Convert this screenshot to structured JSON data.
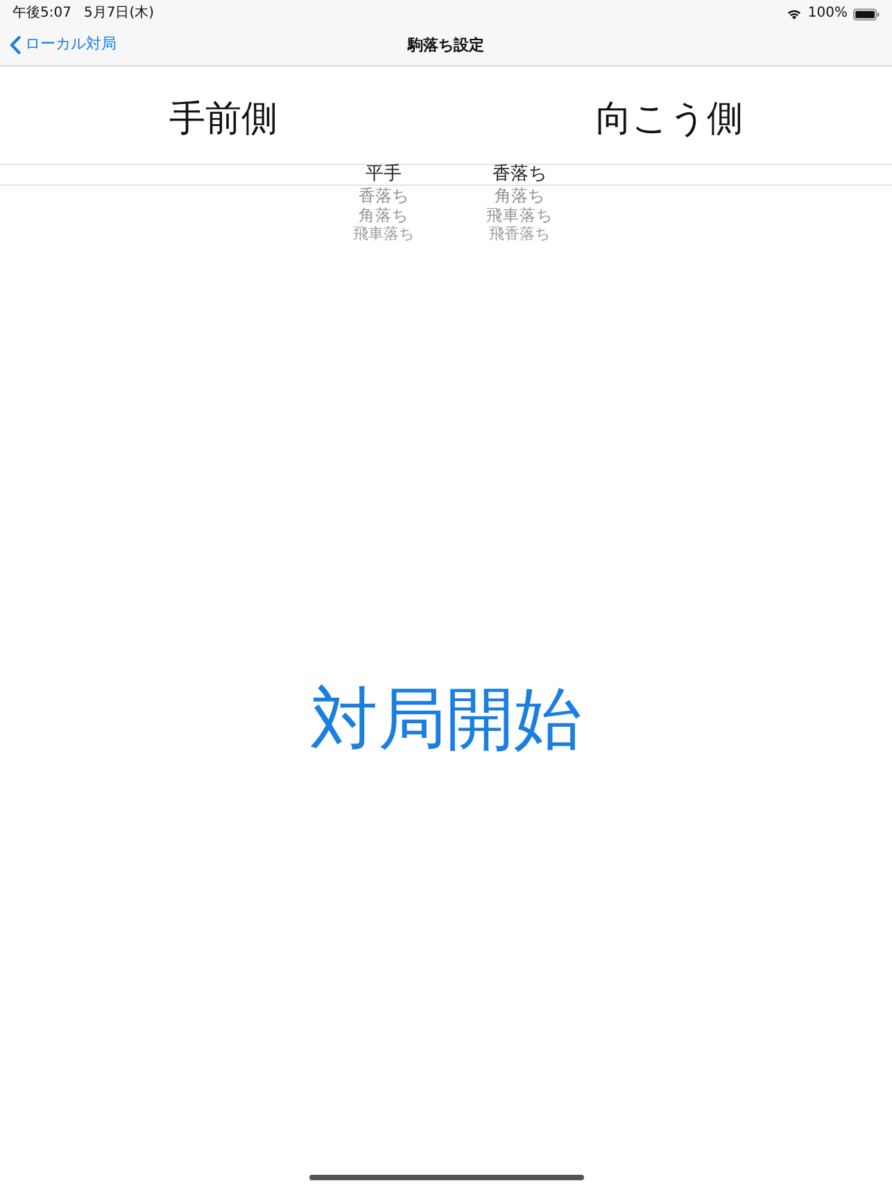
{
  "status_bar": {
    "time": "午後5:07",
    "date": "5月7日(木)",
    "battery": "100%"
  },
  "nav_bar": {
    "back": "ローカル対局",
    "title": "駒落ち設定"
  },
  "headers": [
    "手前側",
    "向こう側"
  ],
  "picker": {
    "columns": [
      {
        "items": [
          {
            "label": "平手",
            "selected": true
          },
          {
            "label": "香落ち",
            "selected": false
          },
          {
            "label": "角落ち",
            "selected": false
          },
          {
            "label": "飛車落ち",
            "selected": false
          }
        ]
      },
      {
        "items": [
          {
            "label": "香落ち",
            "selected": true
          },
          {
            "label": "角落ち",
            "selected": false
          },
          {
            "label": "飛車落ち",
            "selected": false
          },
          {
            "label": "飛香落ち",
            "selected": false
          }
        ]
      }
    ]
  },
  "start_button": "対局開始"
}
